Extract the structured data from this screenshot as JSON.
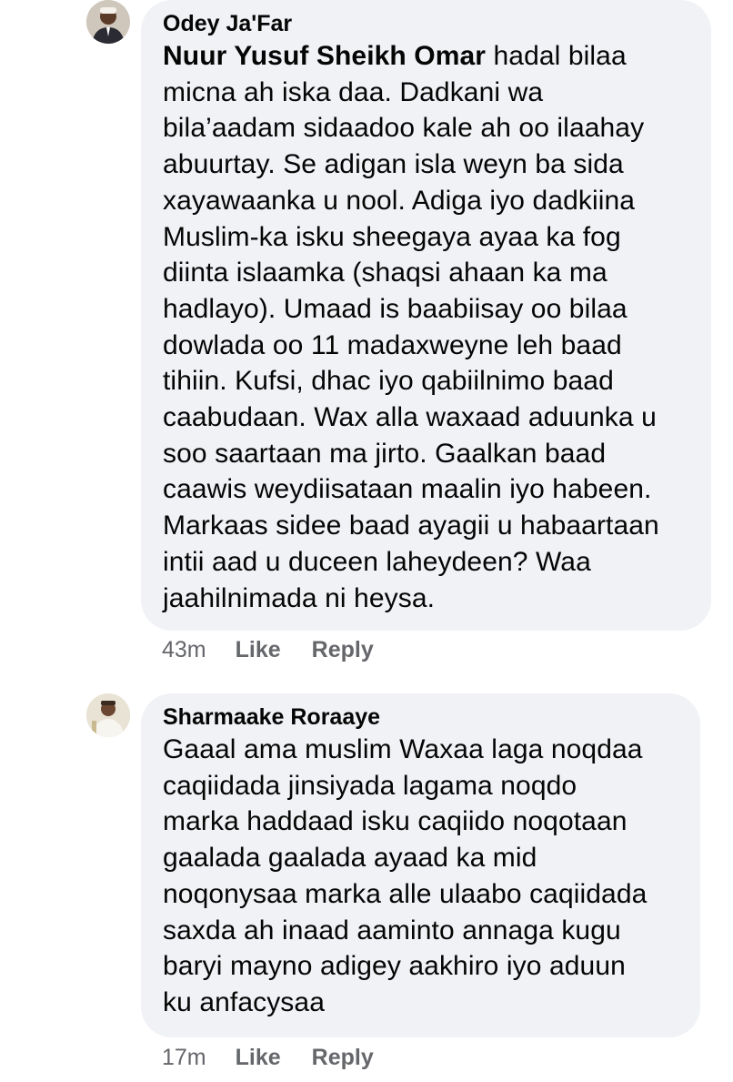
{
  "comments": [
    {
      "author": "Odey Ja'Far",
      "mention": "Nuur Yusuf Sheikh Omar",
      "text": " hadal bilaa\nmicna ah iska daa. Dadkani wa\nbila’aadam sidaadoo kale ah oo ilaahay\nabuurtay. Se adigan isla weyn ba sida\nxayawaanka u nool. Adiga iyo dadkiina\nMuslim-ka isku sheegaya ayaa ka fog\ndiinta islaamka (shaqsi ahaan ka ma\nhadlayo). Umaad is baabiisay oo bilaa\ndowlada oo 11 madaxweyne leh baad\ntihiin. Kufsi, dhac iyo qabiilnimo baad\ncaabudaan. Wax alla waxaad aduunka u\nsoo saartaan ma jirto. Gaalkan baad\ncaawis weydiisataan maalin iyo habeen.\nMarkaas sidee baad ayagii u habaartaan\nintii aad u duceen laheydeen? Waa\njaahilnimada ni heysa.",
      "time": "43m",
      "like_label": "Like",
      "reply_label": "Reply"
    },
    {
      "author": "Sharmaake Roraaye",
      "mention": "",
      "text": "Gaaal ama muslim Waxaa laga noqdaa\ncaqiidada jinsiyada lagama noqdo\nmarka haddaad isku caqiido noqotaan\ngaalada gaalada ayaad ka mid\nnoqonysaa marka alle ulaabo caqiidada\nsaxda ah inaad aaminto annaga kugu\nbaryi mayno adigey aakhiro iyo aduun\nku anfacysaa",
      "time": "17m",
      "like_label": "Like",
      "reply_label": "Reply"
    }
  ]
}
